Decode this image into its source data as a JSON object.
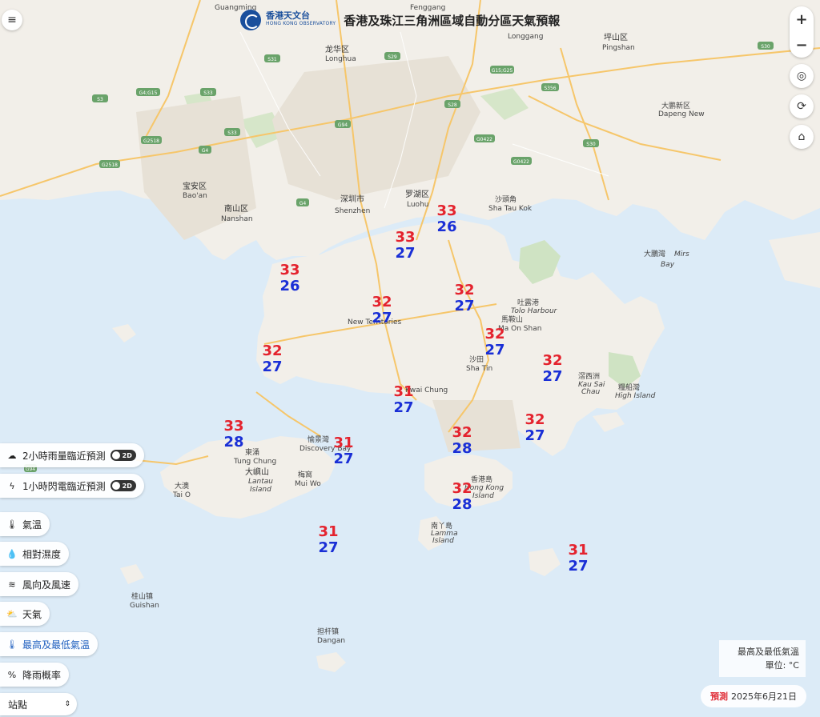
{
  "header": {
    "logo_cn": "香港天文台",
    "logo_en": "HONG KONG OBSERVATORY",
    "title": "香港及珠江三角洲區域自動分區天氣預報"
  },
  "controls": {
    "menu_icon": "≡",
    "zoom_in": "+",
    "zoom_out": "−",
    "locate_icon": "◎",
    "refresh_icon": "⟳",
    "home_icon": "⌂"
  },
  "layers": [
    {
      "label": "2小時雨量臨近預測",
      "icon": "rain-cloud-icon",
      "toggle": "2D"
    },
    {
      "label": "1小時閃電臨近預測",
      "icon": "lightning-icon",
      "toggle": "2D"
    },
    {
      "label": "氣溫",
      "icon": "thermometer-icon"
    },
    {
      "label": "相對濕度",
      "icon": "droplet-icon"
    },
    {
      "label": "風向及風速",
      "icon": "wind-icon"
    },
    {
      "label": "天氣",
      "icon": "weather-icon"
    },
    {
      "label": "最高及最低氣溫",
      "icon": "max-min-thermometer-icon",
      "active": true
    },
    {
      "label": "降雨概率",
      "icon": "percent-icon"
    }
  ],
  "station_select": {
    "value": "站點"
  },
  "legend": {
    "line1": "最高及最低氣溫",
    "line2": "單位: °C"
  },
  "forecast": {
    "tag": "預測",
    "date": "2025年6月21日"
  },
  "temperatures": [
    {
      "max": "33",
      "min": "26"
    },
    {
      "max": "33",
      "min": "27"
    },
    {
      "max": "33",
      "min": "26"
    },
    {
      "max": "32",
      "min": "27"
    },
    {
      "max": "32",
      "min": "27"
    },
    {
      "max": "32",
      "min": "27"
    },
    {
      "max": "32",
      "min": "27"
    },
    {
      "max": "32",
      "min": "27"
    },
    {
      "max": "31",
      "min": "27"
    },
    {
      "max": "33",
      "min": "28"
    },
    {
      "max": "32",
      "min": "27"
    },
    {
      "max": "32",
      "min": "28"
    },
    {
      "max": "31",
      "min": "27"
    },
    {
      "max": "32",
      "min": "28"
    },
    {
      "max": "31",
      "min": "27"
    },
    {
      "max": "31",
      "min": "27"
    }
  ],
  "places": {
    "guangming": "Guangming",
    "fenggang": "Fenggang",
    "longhua_cn": "龙华区",
    "longhua": "Longhua",
    "longgang": "Longgang",
    "pingshan_cn": "坪山区",
    "pingshan": "Pingshan",
    "dapeng_cn": "大鹏新区",
    "dapeng": "Dapeng New",
    "baoan_cn": "宝安区",
    "baoan": "Bao'an",
    "nanshan_cn": "南山区",
    "nanshan": "Nanshan",
    "shenzhen_cn": "深圳市",
    "shenzhen": "Shenzhen",
    "luohu_cn": "罗湖区",
    "luohu": "Luohu",
    "shatoukok_cn": "沙頭角",
    "shatoukok": "Sha Tau Kok",
    "mirsbay_cn": "大鵬灣",
    "mirsbay1": "Mirs",
    "mirsbay2": "Bay",
    "tolo_cn": "吐露港",
    "tolo": "Tolo Harbour",
    "maonshan_cn": "馬鞍山",
    "maonshan": "Ma On Shan",
    "shatin_cn": "沙田",
    "shatin": "Sha Tin",
    "kausaichau_cn": "滘西洲",
    "kausaichau1": "Kau Sai",
    "kausaichau2": "Chau",
    "highisland_cn": "糧船灣",
    "highisland": "High Island",
    "newterritories": "New Territories",
    "kwaichung": "Kwai Chung",
    "tungchung_cn": "東涌",
    "tungchung": "Tung Chung",
    "discoverybay_cn": "愉景灣",
    "discoverybay": "Discovery Bay",
    "lantau_cn": "大嶼山",
    "lantau1": "Lantau",
    "lantau2": "Island",
    "muiwo_cn": "梅窩",
    "muiwo": "Mui Wo",
    "taio_cn": "大澳",
    "taio": "Tai O",
    "hkisland_cn": "香港島",
    "hkisland1": "Hong Kong",
    "hkisland2": "Island",
    "lamma_cn": "南丫島",
    "lamma1": "Lamma",
    "lamma2": "Island",
    "guishan_cn": "桂山镇",
    "guishan": "Guishan",
    "dangan_cn": "担杆镇",
    "dangan": "Dangan"
  }
}
